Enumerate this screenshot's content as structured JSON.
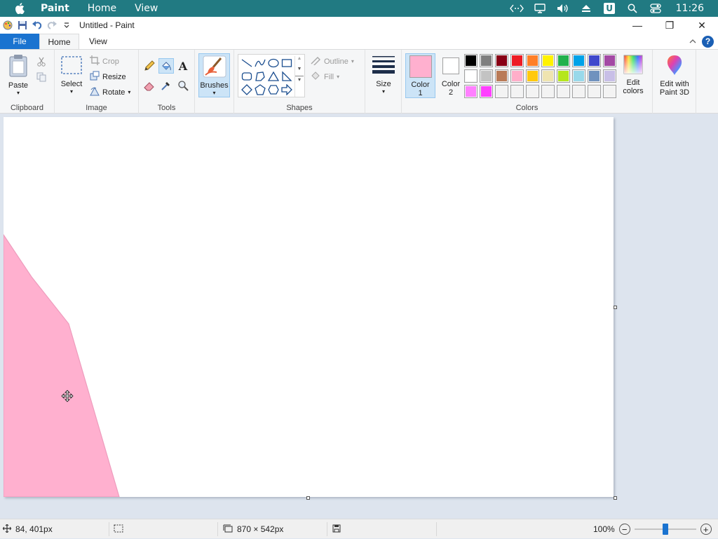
{
  "menubar": {
    "app_name": "Paint",
    "items": [
      "Home",
      "View"
    ],
    "clock": "11:26",
    "status_icons": [
      "code-icon",
      "display-icon",
      "volume-icon",
      "eject-icon",
      "user-u-icon",
      "search-icon",
      "control-center-icon"
    ]
  },
  "titlebar": {
    "title": "Untitled - Paint",
    "minimize": "—",
    "restore": "❐",
    "close": "✕"
  },
  "tabs": {
    "file": "File",
    "home": "Home",
    "view": "View",
    "help": "?"
  },
  "ribbon": {
    "clipboard": {
      "label": "Clipboard",
      "paste": "Paste"
    },
    "image": {
      "label": "Image",
      "select": "Select",
      "crop": "Crop",
      "resize": "Resize",
      "rotate": "Rotate"
    },
    "tools": {
      "label": "Tools"
    },
    "brushes": {
      "label": "Brushes"
    },
    "shapes": {
      "label": "Shapes",
      "outline": "Outline",
      "fill": "Fill"
    },
    "size": {
      "label": "Size"
    },
    "colors": {
      "label": "Colors",
      "color1_label": "Color",
      "color1_num": "1",
      "color2_label": "Color",
      "color2_num": "2",
      "color1_value": "#ffb0cf",
      "color2_value": "#ffffff",
      "edit_colors_line1": "Edit",
      "edit_colors_line2": "colors",
      "palette_row1": [
        "#000000",
        "#7f7f7f",
        "#880015",
        "#ed1c24",
        "#ff7f27",
        "#fff200",
        "#22b14c",
        "#00a2e8",
        "#3f48cc",
        "#a349a4"
      ],
      "palette_row2": [
        "#ffffff",
        "#c3c3c3",
        "#b97a57",
        "#ffaec9",
        "#ffc90e",
        "#efe4b0",
        "#b5e61d",
        "#99d9ea",
        "#7092be",
        "#c8bfe7"
      ],
      "palette_row3": [
        "#ff80ff",
        "#ff40ff",
        "#f3f3f3",
        "#f3f3f3",
        "#f3f3f3",
        "#f3f3f3",
        "#f3f3f3",
        "#f3f3f3",
        "#f3f3f3",
        "#f3f3f3"
      ]
    },
    "paint3d": {
      "line1": "Edit with",
      "line2": "Paint 3D"
    }
  },
  "canvas": {
    "fill_color": "#ffb0cf"
  },
  "statusbar": {
    "cursor_pos": "84, 401px",
    "canvas_size": "870 × 542px",
    "zoom": "100%",
    "zoom_level_percent": 100
  }
}
